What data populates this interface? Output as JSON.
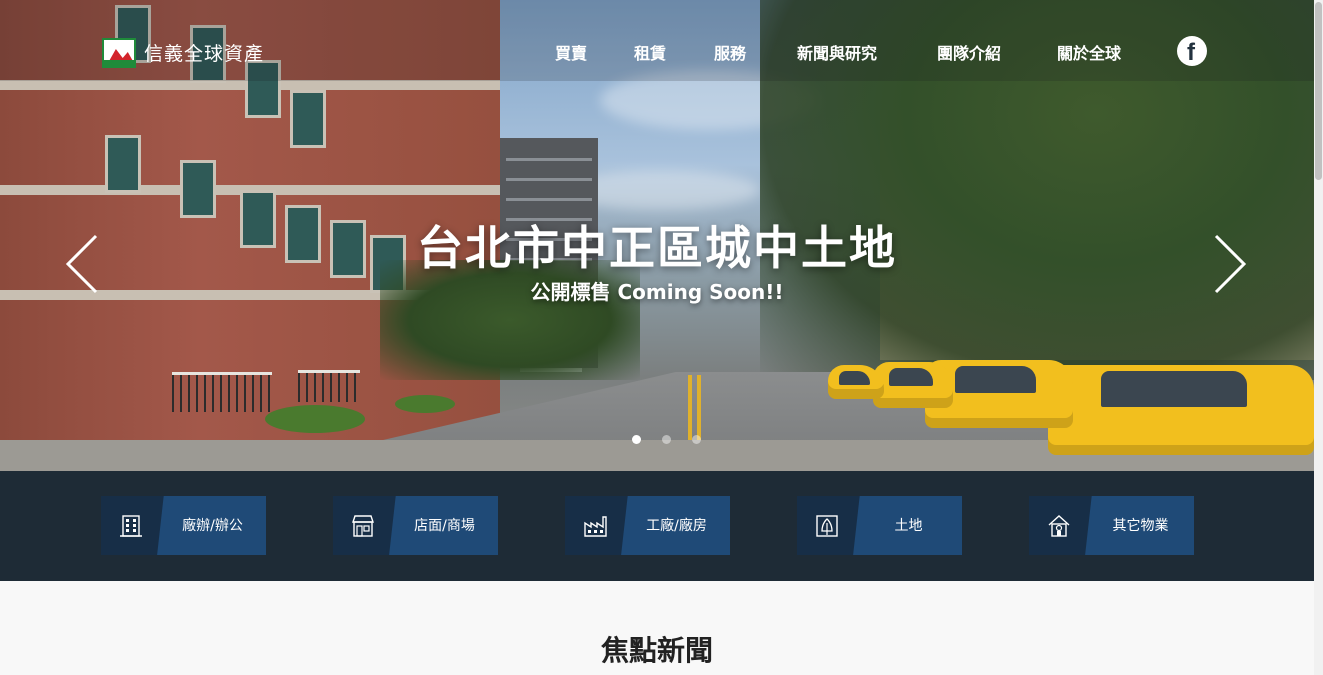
{
  "brand": {
    "name": "信義全球資產"
  },
  "nav": {
    "items": [
      "買賣",
      "租賃",
      "服務",
      "新聞與研究",
      "團隊介紹",
      "關於全球"
    ],
    "social_icon": "facebook-icon"
  },
  "hero": {
    "title": "台北市中正區城中土地",
    "subtitle": "公開標售 Coming Soon!!",
    "prev_icon": "chevron-left-icon",
    "next_icon": "chevron-right-icon",
    "slides_total": 3,
    "active_slide": 1
  },
  "categories": [
    {
      "label": "廠辦/辦公",
      "icon": "office-building-icon"
    },
    {
      "label": "店面/商場",
      "icon": "storefront-icon"
    },
    {
      "label": "工廠/廠房",
      "icon": "factory-icon"
    },
    {
      "label": "土地",
      "icon": "land-icon"
    },
    {
      "label": "其它物業",
      "icon": "house-icon"
    }
  ],
  "section": {
    "title": "焦點新聞"
  },
  "colors": {
    "category_bar_bg": "#1e2b36",
    "category_left": "#172e47",
    "category_right": "#1f4a77",
    "brand_red": "#d3242b",
    "brand_green": "#1f8b3a"
  }
}
